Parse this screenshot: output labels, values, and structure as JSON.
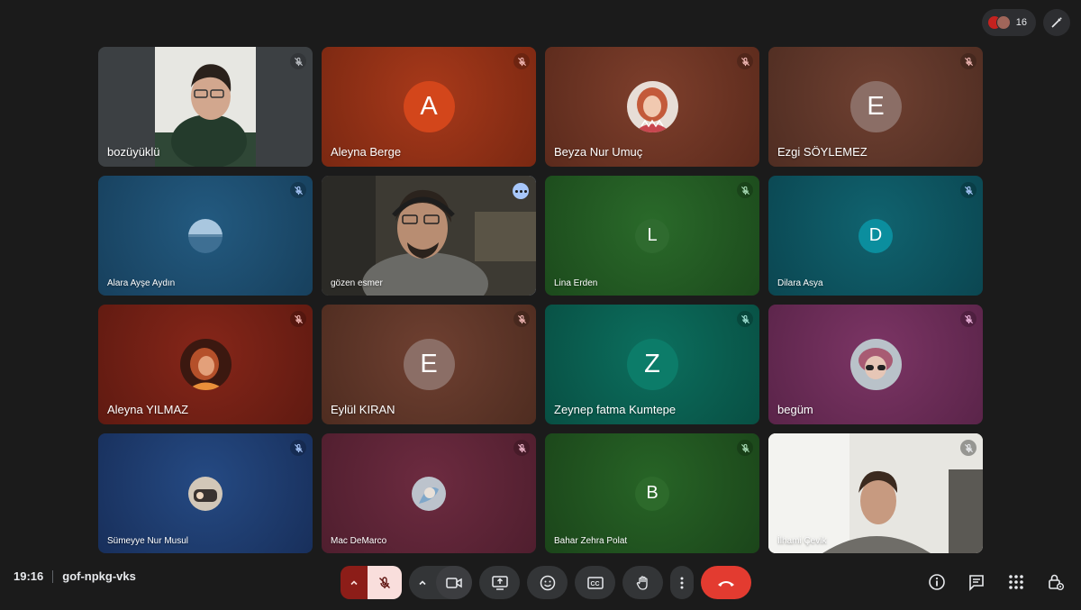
{
  "top": {
    "participant_count": "16"
  },
  "tiles": [
    {
      "name": "bozüyüklü",
      "type": "video",
      "bg": "#3c4043"
    },
    {
      "name": "Aleyna Berge",
      "initial": "A",
      "type": "initial",
      "bg": "#8e2e14",
      "avatar_color": "#d3461b"
    },
    {
      "name": "Beyza Nur Umuç",
      "type": "photo",
      "bg": "#6b3222"
    },
    {
      "name": "Ezgi SÖYLEMEZ",
      "initial": "E",
      "type": "initial",
      "bg": "#5e3528",
      "avatar_color": "#8b6e66"
    },
    {
      "name": "Alara Ayşe Aydın",
      "type": "photo",
      "bg": "#1e4a6b"
    },
    {
      "name": "gözen esmer",
      "type": "video",
      "bg": "#4a4a44"
    },
    {
      "name": "Lina Erden",
      "initial": "L",
      "type": "initial",
      "bg": "#215122",
      "avatar_color": "#2f6b2f"
    },
    {
      "name": "Dilara Asya",
      "initial": "D",
      "type": "initial",
      "bg": "#0d4d57",
      "avatar_color": "#0b8e9e"
    },
    {
      "name": "Aleyna YILMAZ",
      "type": "photo",
      "bg": "#6d1d14"
    },
    {
      "name": "Eylül KIRAN",
      "initial": "E",
      "type": "initial",
      "bg": "#5b3325",
      "avatar_color": "#8b6e66"
    },
    {
      "name": "Zeynep fatma Kumtepe",
      "initial": "Z",
      "type": "initial",
      "bg": "#0a5a4c",
      "avatar_color": "#0c7c69"
    },
    {
      "name": "begüm",
      "type": "photo",
      "bg": "#6a2b55"
    },
    {
      "name": "Sümeyye Nur Musul",
      "type": "photo",
      "bg": "#1d3a6b"
    },
    {
      "name": "Mac DeMarco",
      "type": "photo",
      "bg": "#5b2335"
    },
    {
      "name": "Bahar Zehra Polat",
      "initial": "B",
      "type": "initial",
      "bg": "#1f4d1e",
      "avatar_color": "#2d6a2b"
    },
    {
      "name": "İlhami Çevik",
      "type": "video",
      "bg": "#d9d9d4"
    }
  ],
  "meeting": {
    "time": "19:16",
    "code": "gof-npkg-vks"
  },
  "controls": {
    "mic": "mic-off-icon",
    "camera": "camera-icon",
    "present": "present-screen-icon",
    "reactions": "emoji-icon",
    "captions": "captions-icon",
    "raise_hand": "hand-icon",
    "more": "more-vert-icon",
    "leave": "call-end-icon"
  },
  "right_controls": [
    "info-icon",
    "chat-icon",
    "apps-icon",
    "host-controls-icon"
  ]
}
